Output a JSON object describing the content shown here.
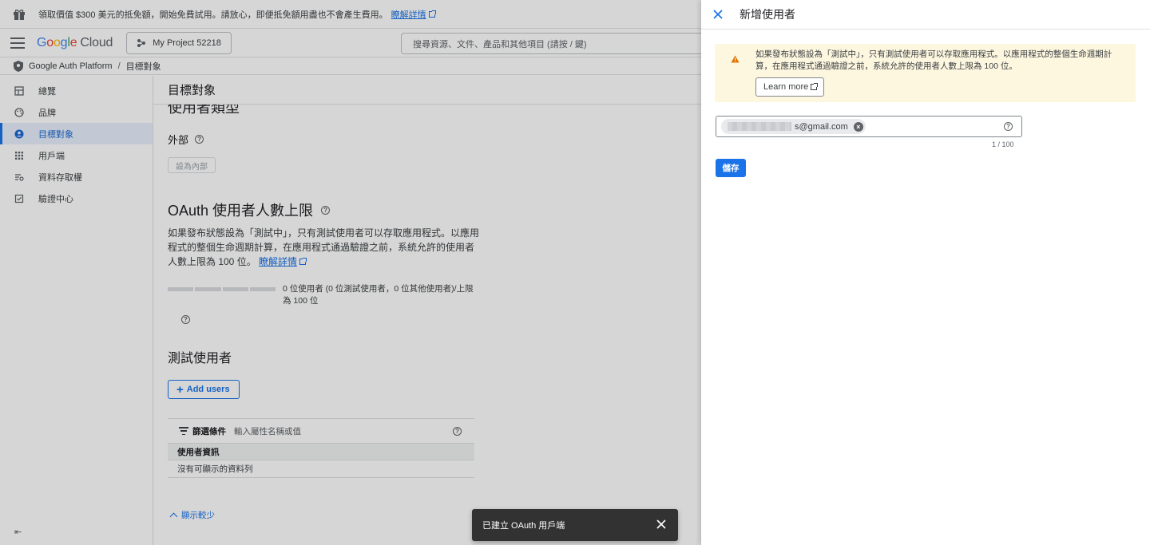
{
  "promo": {
    "text": "領取價值 $300 美元的抵免額，開始免費試用。請放心，即便抵免額用盡也不會產生費用。",
    "link": "瞭解詳情"
  },
  "topbar": {
    "logo": {
      "g1": "G",
      "g2": "o",
      "g3": "o",
      "g4": "g",
      "g5": "l",
      "g6": "e",
      "cloud": "Cloud"
    },
    "project": "My Project 52218",
    "search_placeholder": "搜尋資源、文件、產品和其他項目 (請按 / 鍵)"
  },
  "breadcrumb": {
    "root": "Google Auth Platform",
    "sep": "/",
    "current": "目標對象"
  },
  "sidebar": {
    "items": [
      {
        "label": "總覽",
        "icon": "dashboard-icon"
      },
      {
        "label": "品牌",
        "icon": "palette-icon"
      },
      {
        "label": "目標對象",
        "icon": "person-icon"
      },
      {
        "label": "用戶端",
        "icon": "apps-grid-icon"
      },
      {
        "label": "資料存取權",
        "icon": "data-access-icon"
      },
      {
        "label": "驗證中心",
        "icon": "verification-icon"
      }
    ],
    "collapse": "⇤"
  },
  "content": {
    "header": "目標對象",
    "user_type_title": "使用者類型",
    "user_type_value": "外部",
    "make_internal": "設為內部",
    "oauth_title": "OAuth 使用者人數上限",
    "oauth_desc": "如果發布狀態設為「測試中」，只有測試使用者可以存取應用程式。以應用程式的整個生命週期計算，在應用程式通過驗證之前，系統允許的使用者人數上限為 100 位。",
    "oauth_link": "瞭解詳情",
    "quota_text": "0 位使用者 (0 位測試使用者，0 位其他使用者)/上限為 100 位",
    "testers_title": "測試使用者",
    "add_users": "Add users",
    "filter_label": "篩選條件",
    "filter_placeholder": "輸入屬性名稱或值",
    "table_header": "使用者資訊",
    "table_empty": "沒有可顯示的資料列",
    "show_less": "顯示較少"
  },
  "snackbar": {
    "text": "已建立 OAuth 用戶端"
  },
  "panel": {
    "title": "新增使用者",
    "warning": "如果發布狀態設為「測試中」，只有測試使用者可以存取應用程式。以應用程式的整個生命週期計算，在應用程式通過驗證之前，系統允許的使用者人數上限為 100 位。",
    "learn_more": "Learn more",
    "email_chip": "s@gmail.com",
    "counter": "1 / 100",
    "save": "儲存"
  },
  "colors": {
    "accent": "#1a73e8",
    "warning_bg": "#fef7e0",
    "warning_icon": "#e37400"
  }
}
